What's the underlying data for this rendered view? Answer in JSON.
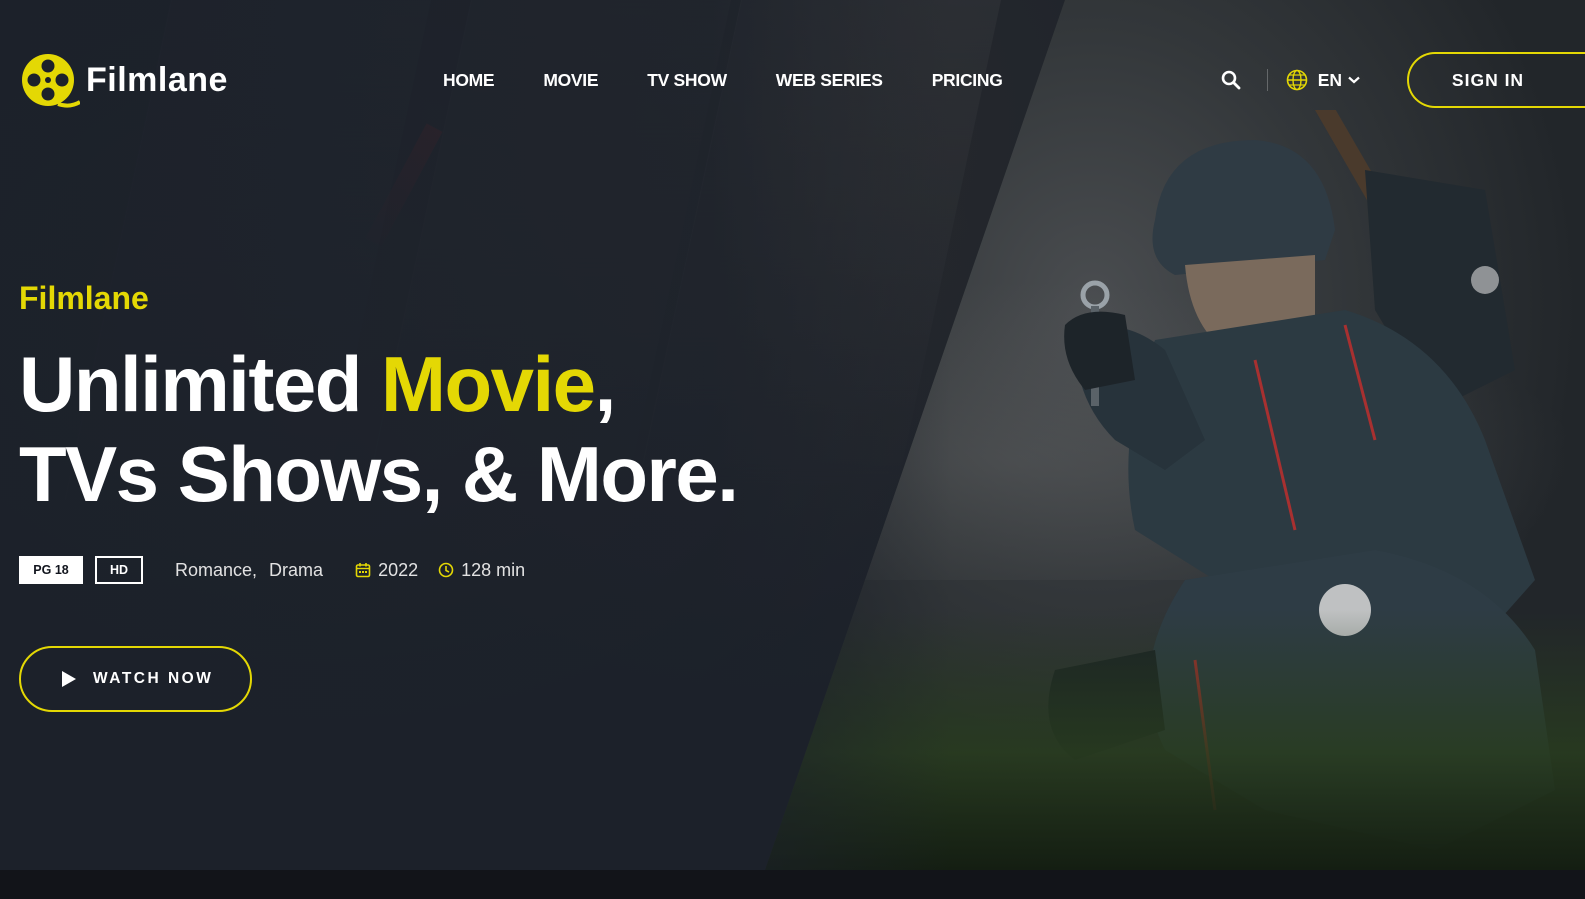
{
  "brand": {
    "name": "Filmlane",
    "accent_color": "#e4d804"
  },
  "nav": {
    "items": [
      {
        "label": "HOME"
      },
      {
        "label": "MOVIE"
      },
      {
        "label": "TV SHOW"
      },
      {
        "label": "WEB SERIES"
      },
      {
        "label": "PRICING"
      }
    ]
  },
  "header": {
    "search_icon": "search-icon",
    "language": {
      "icon": "globe-icon",
      "selected": "EN",
      "caret_icon": "chevron-down-icon"
    },
    "signin_label": "SIGN IN"
  },
  "hero": {
    "subtitle": "Filmlane",
    "headline_part1": "Unlimited ",
    "headline_accent": "Movie",
    "headline_part2": ",",
    "headline_line2": "TVs Shows, & More.",
    "badges": {
      "rating": "PG 18",
      "quality": "HD"
    },
    "genres": [
      "Romance,",
      "Drama"
    ],
    "year": "2022",
    "year_icon": "calendar-icon",
    "duration": "128 min",
    "duration_icon": "clock-icon",
    "cta_label": "WATCH NOW",
    "cta_icon": "play-icon"
  }
}
